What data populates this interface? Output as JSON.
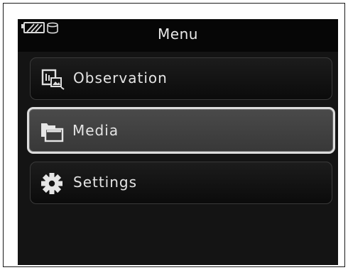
{
  "header": {
    "title": "Menu"
  },
  "status": {
    "icons": [
      "battery-icon",
      "storage-icon"
    ]
  },
  "menu": {
    "items": [
      {
        "label": "Observation",
        "icon": "observation-icon",
        "selected": false
      },
      {
        "label": "Media",
        "icon": "media-folder-icon",
        "selected": true
      },
      {
        "label": "Settings",
        "icon": "gear-icon",
        "selected": false
      }
    ]
  },
  "colors": {
    "screen_bg": "#141414",
    "selected_bg": "#404040",
    "selected_border": "#dcdcdc",
    "text": "#e4e4e4"
  }
}
